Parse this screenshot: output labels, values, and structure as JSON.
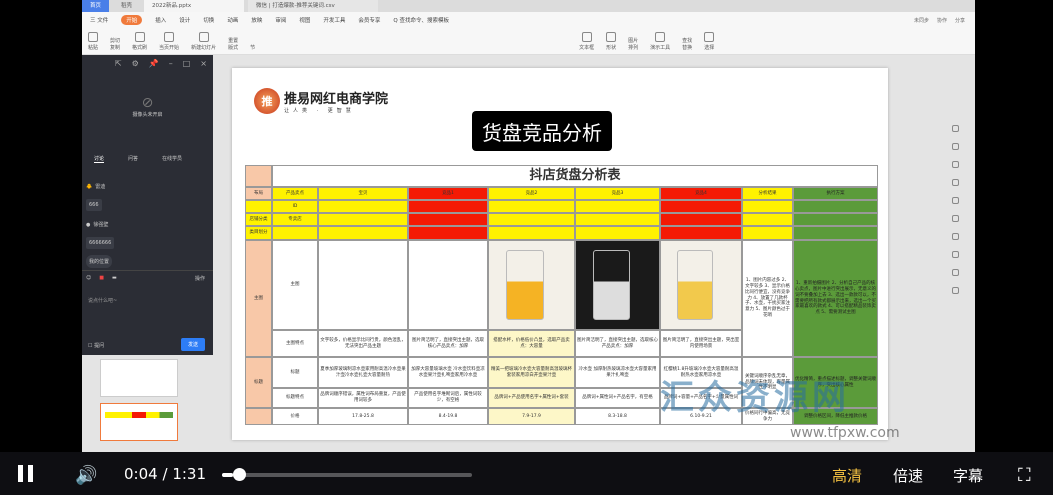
{
  "window": {
    "tabs": [
      "首页",
      "稻壳",
      "2022新品.pptx",
      "微信 | 打造爆款-推荐关键词.csv"
    ],
    "menu": [
      "三 文件",
      "开始",
      "插入",
      "设计",
      "切换",
      "动画",
      "放映",
      "审阅",
      "视图",
      "开发工具",
      "会员专享",
      "Q 查找命令、搜索模板"
    ],
    "ribbon": [
      "粘贴",
      "剪切",
      "复制",
      "格式刷",
      "当页开始",
      "新建幻灯片",
      "版式",
      "节",
      "重置",
      "文本框",
      "形状",
      "图片",
      "排列",
      "演示工具",
      "查找",
      "替换",
      "选择"
    ],
    "right_buttons": [
      "未同步",
      "协作",
      "分享"
    ]
  },
  "chat": {
    "camera_status": "摄像头未开启",
    "tabs": [
      "讨论",
      "问答",
      "在线学员"
    ],
    "messages": [
      {
        "user": "雷迪",
        "text": "666"
      },
      {
        "user": "徐强壁",
        "text": "6666666"
      }
    ],
    "my_position": "我的位置",
    "tools_label": "操作",
    "input_placeholder": "说点什么吧~",
    "anonymous_label": "提问",
    "send_label": "发送"
  },
  "slide": {
    "logo_name": "推易网红电商学院",
    "logo_sub": "让人类 · 更智慧",
    "logo_mark": "推易",
    "title": "货盘竞品分析",
    "table": {
      "title": "抖店货盘分析表",
      "header": [
        "布局",
        "产品卖点",
        "宝贝",
        "竞品1",
        "竞品2",
        "竞品3",
        "竞品4",
        "分析结果",
        "执行方案"
      ],
      "rows_meta": [
        {
          "label": "",
          "value": "ID"
        },
        {
          "label": "店铺分类",
          "value": "专卖店"
        },
        {
          "label": "类目划分",
          "value": ""
        }
      ],
      "section_main": "主图",
      "row_main": "主图",
      "analysis_main": "1、图片内容过多 2、文字较多 3、显示价格比同行便宜，没有竞争力 4、放置了几款杯子、水壶，干扰买家注意力 5、图片颜色过于花哨",
      "plan_main": "1、重新拍摄图片 2、分析自己产品的核心卖点，图片中进行突出展示，无意义的词不要叠加上去 3、选出一款款可以，不需要把所有款式都展示出来，选出一个买家最喜欢的款式 4、可以搭配精品装饰卖点 5、需要测试主图",
      "row_main_points": "主图特点",
      "main_points": [
        "文字较多，价格显示比同行贵，颜色混乱，无法突出产品主题",
        "图片简洁明了，直接突出主题，选取核心产品卖点：加厚",
        "搭配水杯，价格低价凸显，选取产品卖点：大容量",
        "图片简洁明了，直接突出主题，选取核心产品卖点：加厚",
        "图片简洁明了，直接突出主题，突出室内使用场景"
      ],
      "section_title": "标题",
      "row_title": "标题",
      "titles": [
        "夏季加厚玻璃制凉水壶家用耐高温冷水壶果汁壶冷水壶扎壶大容量耐热",
        "加厚大容量玻璃水壶 冷水壶饮料壶凉水壶果汁壶扎啤壶家用冷水壶",
        "精美一把玻璃冷水壶大容量耐高温玻璃杯套装家用凉白开壶果汁壶",
        "冷水壶 加厚耐热玻璃凉水壶大容量家用果汁扎啤壶",
        "红樱桃1.8升玻璃冷水壶大容量耐高温耐热水壶家用凉水壶"
      ],
      "analysis_title": "关键词顺序杂乱无章，品牌词未体现，容量属性不明显",
      "plan_title": "优化精简，重点描述标题，调整关键词顺序，突出核心属性",
      "row_title_points": "标题特点",
      "title_points": [
        "品牌词顺序错误，属性词布局重复，产品使用词较多",
        "产品使用名字堆砌词后，属性词较少，有空格",
        "品牌词+产品使用名字+属性词+套装",
        "品牌词+属性词+产品名字，有空格",
        "品牌词+容量+产品名字+少量属性词"
      ],
      "row_price": "价格",
      "prices": [
        "17.8-25.8",
        "8.4-19.8",
        "7.9-17.9",
        "8.3-18.8",
        "6.10-9.21"
      ],
      "analysis_price": "价格同行中偏高，无竞争力",
      "plan_price": "调整价格区间，降低主推款价格"
    }
  },
  "watermark": {
    "text": "汇众资源网",
    "url": "www.tfpxw.com"
  },
  "player": {
    "current_time": "0:04",
    "separator": "/",
    "duration": "1:31",
    "progress_percent": 4.4,
    "quality": "高清",
    "speed": "倍速",
    "subtitle": "字幕",
    "accent": "#f5c242"
  }
}
